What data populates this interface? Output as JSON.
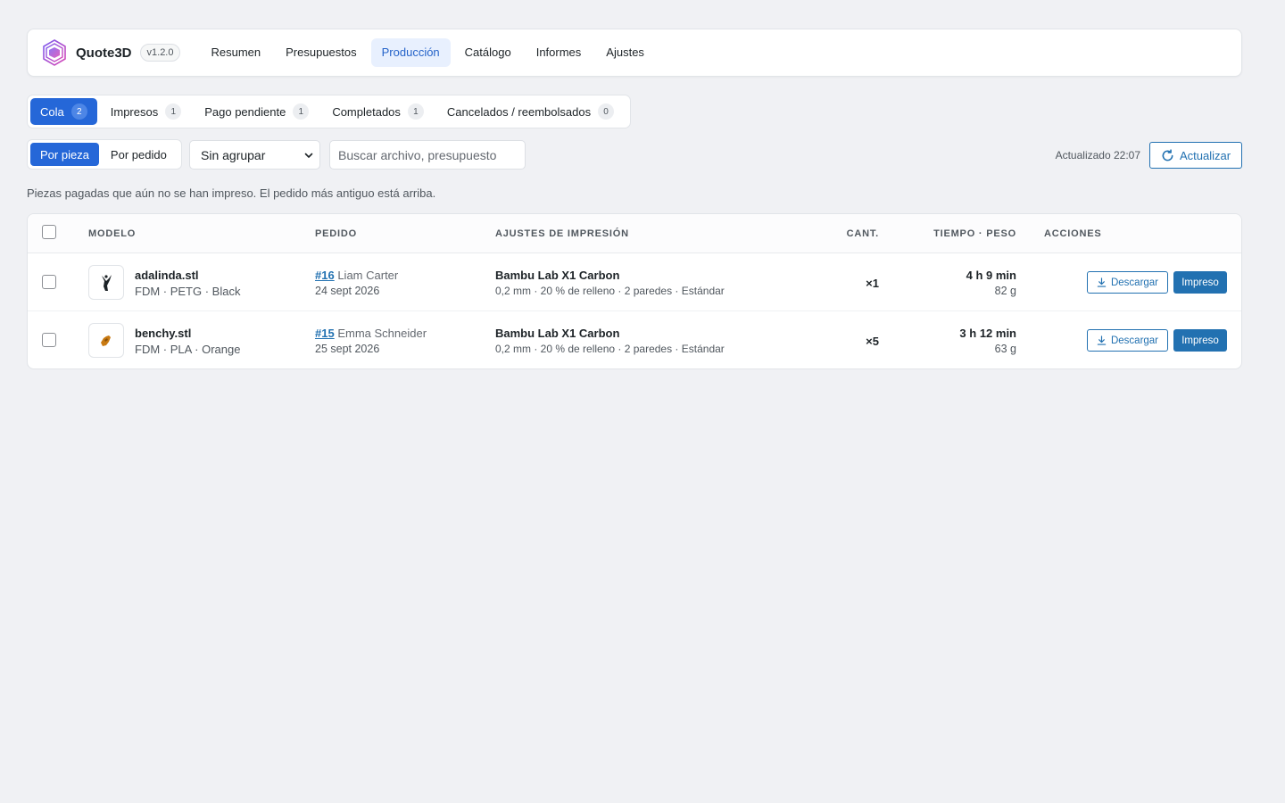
{
  "app": {
    "brand": "Quote3D",
    "version": "v1.2.0"
  },
  "nav": [
    {
      "label": "Resumen",
      "active": false
    },
    {
      "label": "Presupuestos",
      "active": false
    },
    {
      "label": "Producción",
      "active": true
    },
    {
      "label": "Catálogo",
      "active": false
    },
    {
      "label": "Informes",
      "active": false
    },
    {
      "label": "Ajustes",
      "active": false
    }
  ],
  "status_tabs": [
    {
      "label": "Cola",
      "count": "2",
      "active": true
    },
    {
      "label": "Impresos",
      "count": "1",
      "active": false
    },
    {
      "label": "Pago pendiente",
      "count": "1",
      "active": false
    },
    {
      "label": "Completados",
      "count": "1",
      "active": false
    },
    {
      "label": "Cancelados / reembolsados",
      "count": "0",
      "active": false
    }
  ],
  "toolbar": {
    "view_by_piece": "Por pieza",
    "view_by_order": "Por pedido",
    "group_select_value": "Sin agrupar",
    "search_placeholder": "Buscar archivo, presupuesto",
    "updated_text": "Actualizado 22:07",
    "refresh_label": "Actualizar"
  },
  "helper_text": "Piezas pagadas que aún no se han impreso. El pedido más antiguo está arriba.",
  "table": {
    "headers": {
      "model": "MODELO",
      "order": "PEDIDO",
      "settings": "AJUSTES DE IMPRESIÓN",
      "qty": "CANT.",
      "time_weight": "TIEMPO · PESO",
      "actions": "ACCIONES"
    },
    "rows": [
      {
        "file": "adalinda.stl",
        "meta": "FDM · PETG · Black",
        "order_id": "#16",
        "customer": "Liam Carter",
        "date": "24 sept 2026",
        "printer": "Bambu Lab X1 Carbon",
        "settings": "0,2 mm · 20 % de relleno · 2 paredes · Estándar",
        "qty": "×1",
        "time": "4 h 9 min",
        "weight": "82 g",
        "thumb_color": "#1d2327",
        "download_label": "Descargar",
        "printed_label": "Impreso"
      },
      {
        "file": "benchy.stl",
        "meta": "FDM · PLA · Orange",
        "order_id": "#15",
        "customer": "Emma Schneider",
        "date": "25 sept 2026",
        "printer": "Bambu Lab X1 Carbon",
        "settings": "0,2 mm · 20 % de relleno · 2 paredes · Estándar",
        "qty": "×5",
        "time": "3 h 12 min",
        "weight": "63 g",
        "thumb_color": "#c97a12",
        "download_label": "Descargar",
        "printed_label": "Impreso"
      }
    ]
  },
  "colors": {
    "accent": "#2567d8",
    "link": "#2271b1",
    "background": "#f0f1f4"
  }
}
